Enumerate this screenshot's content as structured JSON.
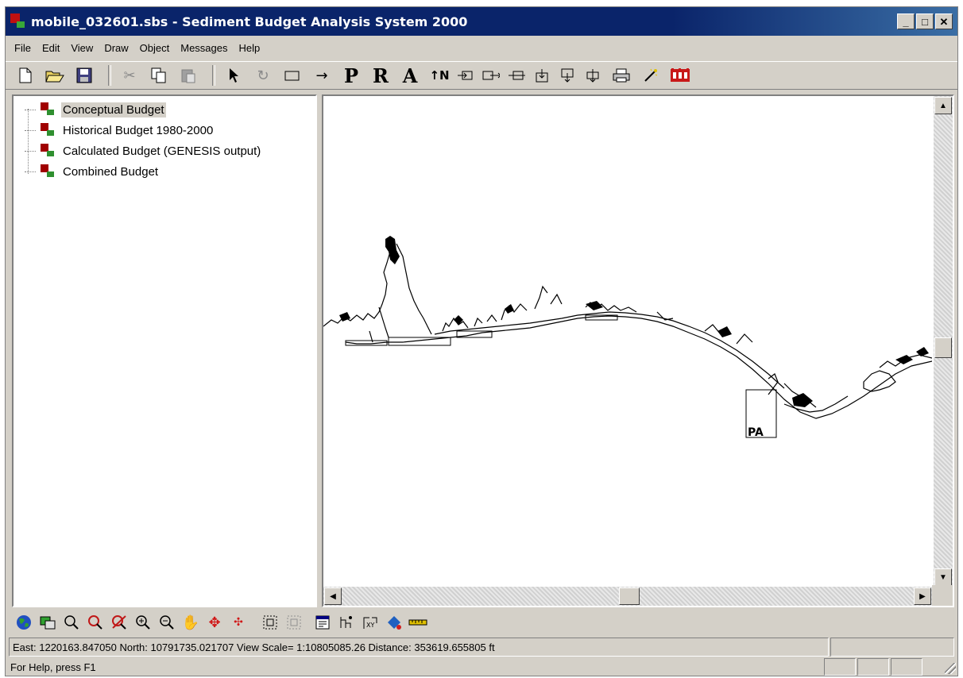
{
  "window": {
    "title": "mobile_032601.sbs - Sediment Budget Analysis System 2000",
    "controls": [
      "_",
      "□",
      "✕"
    ]
  },
  "menubar": {
    "items": [
      {
        "label": "File"
      },
      {
        "label": "Edit"
      },
      {
        "label": "View"
      },
      {
        "label": "Draw"
      },
      {
        "label": "Object"
      },
      {
        "label": "Messages"
      },
      {
        "label": "Help"
      }
    ]
  },
  "toolbar": {
    "icons": [
      "new-file-icon",
      "open-folder-icon",
      "save-icon",
      "cut-icon",
      "copy-icon",
      "paste-icon",
      "select-arrow-icon",
      "rotate-icon",
      "rectangle-icon",
      "arrow-icon",
      "p-tool",
      "r-tool",
      "a-tool",
      "north-arrow-icon",
      "source-icon",
      "sink-icon",
      "bypass-icon",
      "inflow-icon",
      "outflow-icon",
      "transfer-icon",
      "print-icon",
      "wizard-icon",
      "corps-castle-icon"
    ],
    "letters": {
      "p": "P",
      "r": "R",
      "a": "A",
      "north": "↑N"
    }
  },
  "tree": {
    "items": [
      {
        "label": "Conceptual Budget",
        "selected": true
      },
      {
        "label": "Historical Budget 1980-2000",
        "selected": false
      },
      {
        "label": "Calculated Budget (GENESIS output)",
        "selected": false
      },
      {
        "label": "Combined Budget",
        "selected": false
      }
    ]
  },
  "map_toolbar": {
    "icons": [
      "globe-icon",
      "layers-icon",
      "zoom-icon",
      "zoom-red-icon",
      "zoom-clear-icon",
      "zoom-in-icon",
      "zoom-out-icon",
      "pan-hand-icon",
      "move-cross-icon",
      "move-cross-small-icon",
      "select-box-icon",
      "select-box-dim-icon",
      "properties-icon",
      "network-icon",
      "polyline-icon",
      "paint-icon",
      "ruler-icon"
    ]
  },
  "status": {
    "coords": "East: 1220163.847050  North: 10791735.021707  View Scale= 1:10805085.26 Distance:  353619.655805 ft",
    "help": "For Help, press F1"
  },
  "colors": {
    "title_bar": "#0a246a",
    "chrome": "#d4d0c8",
    "node_red": "#a00000",
    "node_green": "#2f8f2f"
  }
}
